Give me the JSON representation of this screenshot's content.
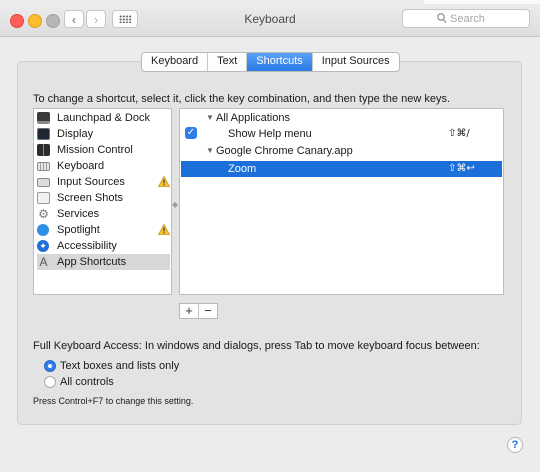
{
  "window": {
    "title": "Keyboard"
  },
  "search": {
    "placeholder": "Search"
  },
  "tabs": [
    {
      "label": "Keyboard",
      "active": false
    },
    {
      "label": "Text",
      "active": false
    },
    {
      "label": "Shortcuts",
      "active": true
    },
    {
      "label": "Input Sources",
      "active": false
    }
  ],
  "instructions": "To change a shortcut, select it, click the key combination, and then type the new keys.",
  "categories": [
    {
      "label": "Launchpad & Dock",
      "icon": "launchpad-dock-icon",
      "warning": false
    },
    {
      "label": "Display",
      "icon": "display-icon",
      "warning": false
    },
    {
      "label": "Mission Control",
      "icon": "mission-control-icon",
      "warning": false
    },
    {
      "label": "Keyboard",
      "icon": "keyboard-icon",
      "warning": false
    },
    {
      "label": "Input Sources",
      "icon": "input-sources-icon",
      "warning": true
    },
    {
      "label": "Screen Shots",
      "icon": "screen-shots-icon",
      "warning": false
    },
    {
      "label": "Services",
      "icon": "services-gear-icon",
      "warning": false
    },
    {
      "label": "Spotlight",
      "icon": "spotlight-icon",
      "warning": true
    },
    {
      "label": "Accessibility",
      "icon": "accessibility-icon",
      "warning": false
    },
    {
      "label": "App Shortcuts",
      "icon": "app-shortcuts-icon",
      "warning": false,
      "selected": true
    }
  ],
  "shortcuts": [
    {
      "label": "All Applications",
      "type": "group"
    },
    {
      "label": "Show Help menu",
      "type": "item",
      "checked": true,
      "keys": "⇧⌘/"
    },
    {
      "label": "Google Chrome Canary.app",
      "type": "group"
    },
    {
      "label": "Zoom",
      "type": "item",
      "checked": false,
      "keys": "⇧⌘↩",
      "selected": true
    }
  ],
  "buttons": {
    "add": "+",
    "remove": "−"
  },
  "full_keyboard_access": {
    "label": "Full Keyboard Access: In windows and dialogs, press Tab to move keyboard focus between:",
    "options": [
      {
        "label": "Text boxes and lists only",
        "selected": true
      },
      {
        "label": "All controls",
        "selected": false
      }
    ],
    "hint": "Press Control+F7 to change this setting."
  },
  "help": "?",
  "colors": {
    "accent": "#2f7de9",
    "selection": "#1a6fd9",
    "panel": "#e3e3e3"
  }
}
